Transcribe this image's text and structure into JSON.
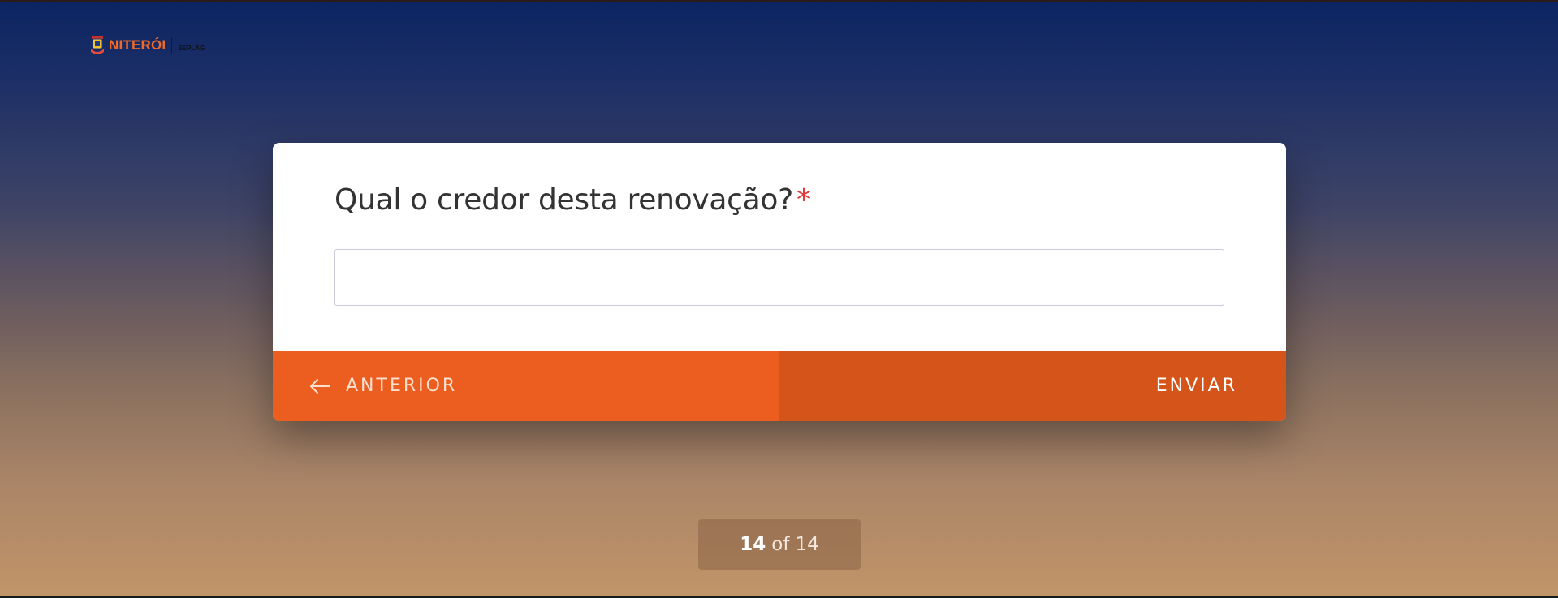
{
  "header": {
    "logo_text": "NITERÓI",
    "logo_sub": "SEPLAG",
    "logo_icon": "niteroi-crest-icon"
  },
  "question": {
    "text": "Qual o credor desta renovação?",
    "required_mark": "*",
    "answer_value": "",
    "answer_placeholder": ""
  },
  "navigation": {
    "prev_label": "ANTERIOR",
    "prev_icon": "arrow-left-icon",
    "next_label": "ENVIAR"
  },
  "progress": {
    "current": "14",
    "separator": "of",
    "total": "14"
  },
  "colors": {
    "accent": "#ec5e1f",
    "accent_dark": "#d45419",
    "required": "#e03a3a",
    "bg_top": "#0b2463",
    "bg_bottom": "#c19569"
  }
}
